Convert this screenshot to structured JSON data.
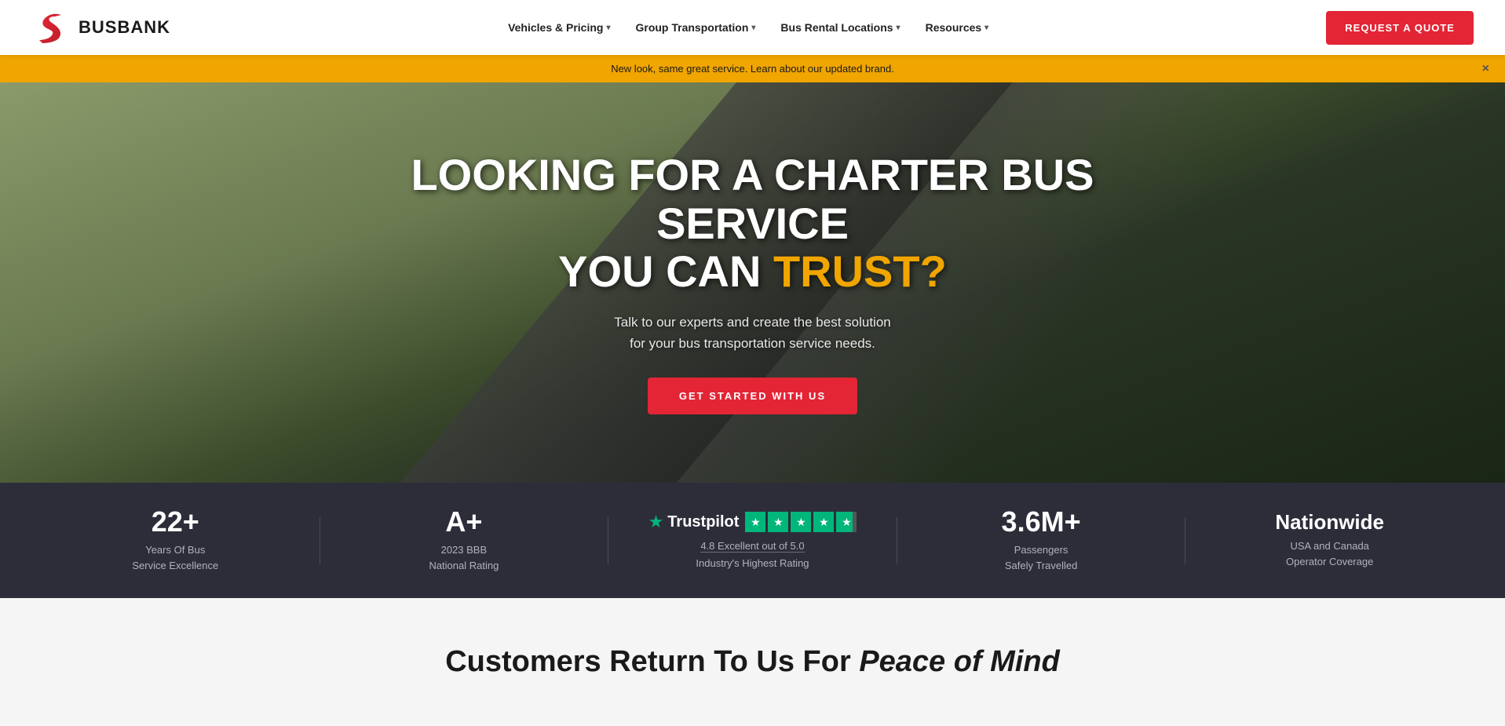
{
  "header": {
    "logo_text": "BUSBANK",
    "nav_items": [
      {
        "label": "Vehicles & Pricing",
        "has_dropdown": true
      },
      {
        "label": "Group Transportation",
        "has_dropdown": true
      },
      {
        "label": "Bus Rental Locations",
        "has_dropdown": true
      },
      {
        "label": "Resources",
        "has_dropdown": true
      }
    ],
    "cta_button": "REQUEST A QUOTE"
  },
  "banner": {
    "text": "New look, same great service. Learn about our updated brand.",
    "close_label": "×"
  },
  "hero": {
    "title_line1": "LOOKING FOR A CHARTER BUS SERVICE",
    "title_line2_prefix": "YOU CAN ",
    "title_line2_highlight": "TRUST?",
    "subtitle_line1": "Talk to our experts and create the best solution",
    "subtitle_line2": "for your bus transportation service needs.",
    "cta_button": "GET STARTED WITH US"
  },
  "stats": [
    {
      "id": "years",
      "value": "22+",
      "label_line1": "Years Of Bus",
      "label_line2": "Service Excellence"
    },
    {
      "id": "bbb",
      "value": "A+",
      "label_line1": "2023 BBB",
      "label_line2": "National Rating"
    },
    {
      "id": "trustpilot",
      "brand": "Trustpilot",
      "rating_text": "4.8 Excellent out of 5.0",
      "rating_sub": "Industry's Highest Rating",
      "stars": 4.8
    },
    {
      "id": "passengers",
      "value": "3.6M+",
      "label_line1": "Passengers",
      "label_line2": "Safely Travelled"
    },
    {
      "id": "nationwide",
      "value": "Nationwide",
      "label_line1": "USA and Canada",
      "label_line2": "Operator Coverage"
    }
  ],
  "customers_section": {
    "title_prefix": "Customers Return To Us For ",
    "title_highlight": "Peace of Mind"
  }
}
